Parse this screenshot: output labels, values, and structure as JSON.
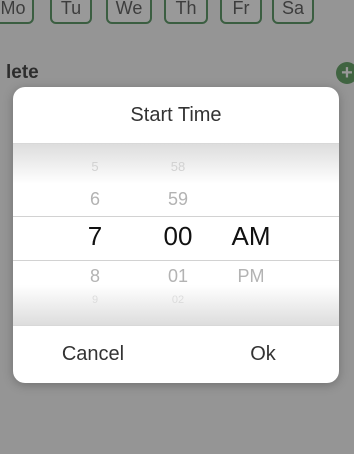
{
  "background": {
    "days": [
      "Mo",
      "Tu",
      "We",
      "Th",
      "Fr",
      "Sa"
    ],
    "section_label": "lete",
    "add_icon": "plus-circle-icon",
    "accent_color": "#2f7d3c"
  },
  "dialog": {
    "title": "Start Time",
    "cancel_label": "Cancel",
    "ok_label": "Ok",
    "picker": {
      "hour": {
        "before": [
          "5",
          "6"
        ],
        "selected": "7",
        "after": [
          "8",
          "9"
        ]
      },
      "minute": {
        "before": [
          "58",
          "59"
        ],
        "selected": "00",
        "after": [
          "01",
          "02"
        ]
      },
      "period": {
        "before": [],
        "selected": "AM",
        "after": [
          "PM"
        ]
      }
    }
  }
}
